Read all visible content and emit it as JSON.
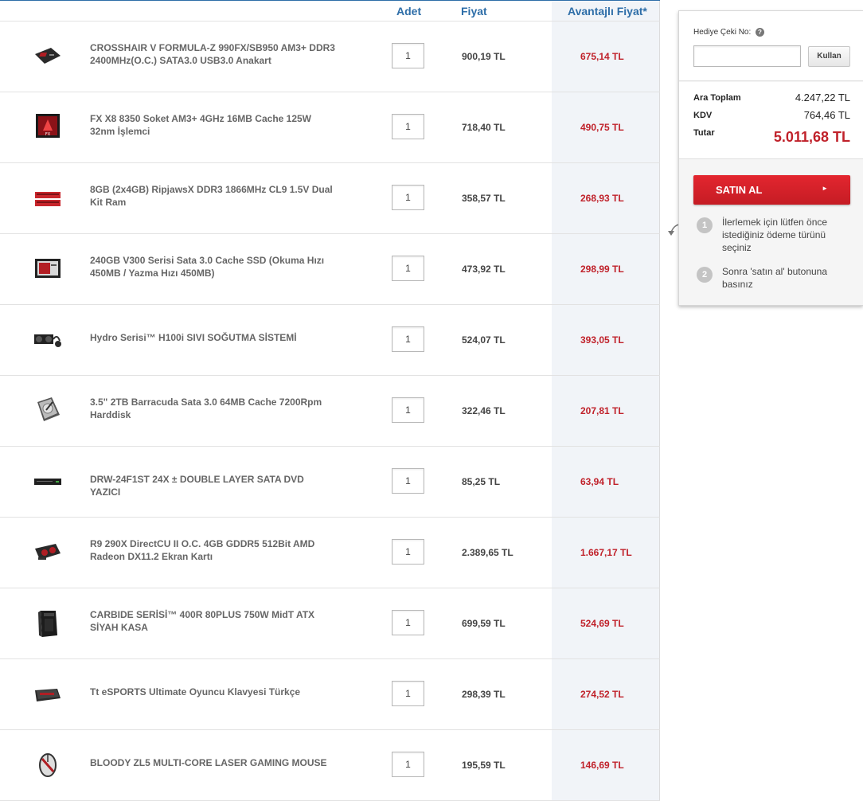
{
  "table": {
    "headers": {
      "quantity": "Adet",
      "price": "Fiyat",
      "advantage_price": "Avantajlı Fiyat*"
    },
    "items": [
      {
        "name": "CROSSHAIR V FORMULA-Z 990FX/SB950 AM3+ DDR3 2400MHz(O.C.) SATA3.0 USB3.0 Anakart",
        "qty": "1",
        "price": "900,19 TL",
        "advantage_price": "675,14 TL",
        "icon": "motherboard-icon"
      },
      {
        "name": "FX X8 8350 Soket AM3+ 4GHz 16MB Cache 125W 32nm İşlemci",
        "qty": "1",
        "price": "718,40 TL",
        "advantage_price": "490,75 TL",
        "icon": "cpu-icon"
      },
      {
        "name": "8GB (2x4GB) RipjawsX DDR3 1866MHz CL9 1.5V Dual Kit Ram",
        "qty": "1",
        "price": "358,57 TL",
        "advantage_price": "268,93 TL",
        "icon": "ram-icon"
      },
      {
        "name": "240GB V300 Serisi Sata 3.0 Cache SSD (Okuma Hızı 450MB / Yazma Hızı 450MB)",
        "qty": "1",
        "price": "473,92 TL",
        "advantage_price": "298,99 TL",
        "icon": "ssd-icon"
      },
      {
        "name": "Hydro Serisi™ H100i SIVI SOĞUTMA SİSTEMİ",
        "qty": "1",
        "price": "524,07 TL",
        "advantage_price": "393,05 TL",
        "icon": "cooler-icon"
      },
      {
        "name": "3.5\" 2TB Barracuda Sata 3.0 64MB Cache 7200Rpm Harddisk",
        "qty": "1",
        "price": "322,46 TL",
        "advantage_price": "207,81 TL",
        "icon": "hdd-icon"
      },
      {
        "name": "DRW-24F1ST 24X ± DOUBLE LAYER SATA DVD YAZICI",
        "qty": "1",
        "price": "85,25 TL",
        "advantage_price": "63,94 TL",
        "icon": "dvd-drive-icon"
      },
      {
        "name": "R9 290X DirectCU II O.C. 4GB GDDR5 512Bit AMD Radeon DX11.2 Ekran Kartı",
        "qty": "1",
        "price": "2.389,65 TL",
        "advantage_price": "1.667,17 TL",
        "icon": "gpu-icon"
      },
      {
        "name": "CARBIDE SERİSİ™ 400R 80PLUS 750W MidT ATX SİYAH KASA",
        "qty": "1",
        "price": "699,59 TL",
        "advantage_price": "524,69 TL",
        "icon": "pc-case-icon"
      },
      {
        "name": "Tt eSPORTS Ultimate Oyuncu Klavyesi Türkçe",
        "qty": "1",
        "price": "298,39 TL",
        "advantage_price": "274,52 TL",
        "icon": "keyboard-icon"
      },
      {
        "name": "BLOODY ZL5 MULTI-CORE LASER GAMING MOUSE",
        "qty": "1",
        "price": "195,59 TL",
        "advantage_price": "146,69 TL",
        "icon": "mouse-icon"
      }
    ]
  },
  "summary": {
    "gift_label": "Hediye Çeki No:",
    "gift_help": "?",
    "gift_value": "",
    "apply_label": "Kullan",
    "subtotal_label": "Ara Toplam",
    "subtotal_value": "4.247,22 TL",
    "vat_label": "KDV",
    "vat_value": "764,46 TL",
    "total_label": "Tutar",
    "total_value": "5.011,68 TL",
    "buy_label": "SATIN AL",
    "buy_arrow": "►",
    "steps": [
      {
        "num": "1",
        "text": "İlerlemek için lütfen önce istediğiniz ödeme türünü seçiniz"
      },
      {
        "num": "2",
        "text": "Sonra 'satın al' butonuna basınız"
      }
    ]
  },
  "colors": {
    "header_blue": "#2e6ea8",
    "price_red": "#c0212a",
    "advantage_column_bg": "#f1f4f8"
  }
}
